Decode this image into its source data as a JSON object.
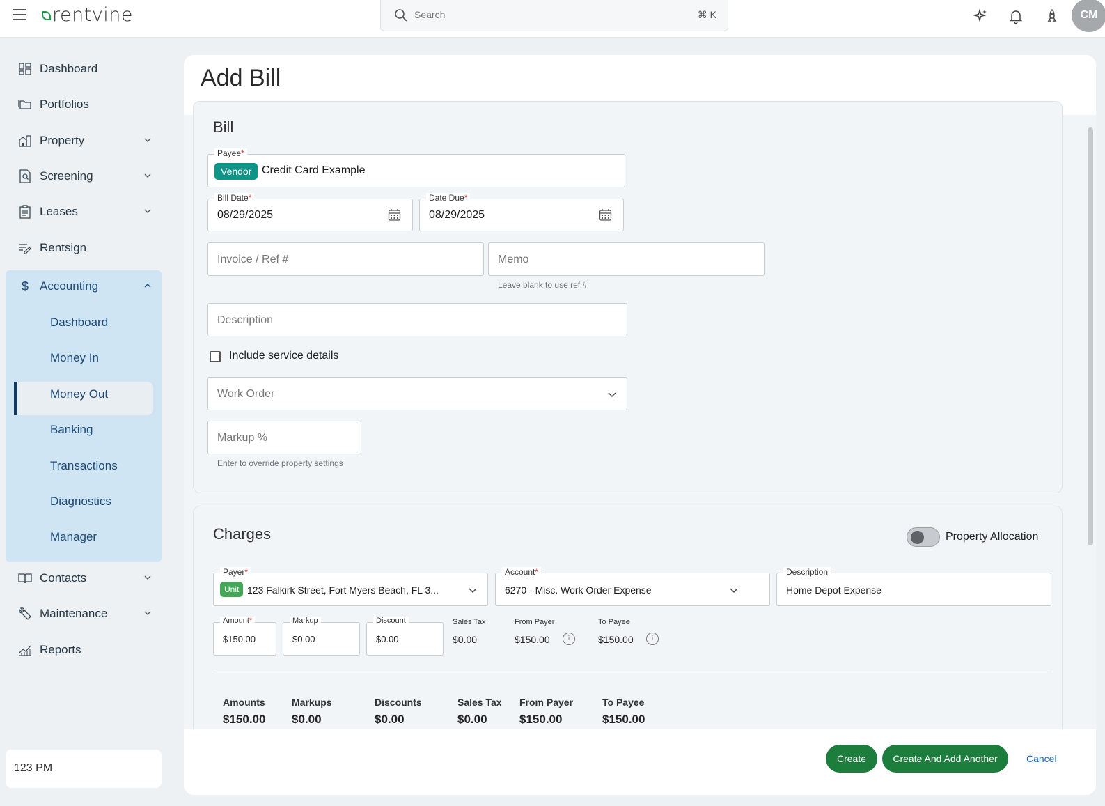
{
  "app": {
    "logo_text": "rentvine"
  },
  "search": {
    "placeholder": "Search",
    "shortcut": "⌘ K"
  },
  "user": {
    "initials": "CM"
  },
  "sidebar": {
    "items": [
      {
        "label": "Dashboard",
        "icon": "grid-icon"
      },
      {
        "label": "Portfolios",
        "icon": "folders-icon"
      },
      {
        "label": "Property",
        "icon": "building-icon"
      },
      {
        "label": "Screening",
        "icon": "document-search-icon"
      },
      {
        "label": "Leases",
        "icon": "clipboard-icon"
      },
      {
        "label": "Rentsign",
        "icon": "signature-icon"
      },
      {
        "label": "Accounting",
        "icon": "dollar-icon"
      },
      {
        "label": "Contacts",
        "icon": "book-icon"
      },
      {
        "label": "Maintenance",
        "icon": "wrench-icon"
      },
      {
        "label": "Reports",
        "icon": "chart-icon"
      }
    ],
    "accounting_sub": [
      "Dashboard",
      "Money In",
      "Money Out",
      "Banking",
      "Transactions",
      "Diagnostics",
      "Manager"
    ],
    "active_sub": "Money Out",
    "footer_time": "123 PM"
  },
  "page": {
    "title": "Add Bill"
  },
  "bill": {
    "section_title": "Bill",
    "payee": {
      "label": "Payee",
      "tag": "Vendor",
      "value": "Credit Card Example"
    },
    "bill_date": {
      "label": "Bill Date",
      "value": "08/29/2025"
    },
    "date_due": {
      "label": "Date Due",
      "value": "08/29/2025"
    },
    "invoice": {
      "placeholder": "Invoice / Ref #"
    },
    "memo": {
      "placeholder": "Memo",
      "helper": "Leave blank to use ref #"
    },
    "description": {
      "placeholder": "Description"
    },
    "service_details": {
      "label": "Include service details",
      "checked": false
    },
    "work_order": {
      "placeholder": "Work Order"
    },
    "markup": {
      "placeholder": "Markup %",
      "helper": "Enter to override property settings"
    }
  },
  "charges": {
    "section_title": "Charges",
    "allocation_label": "Property Allocation",
    "allocation_on": false,
    "payer": {
      "label": "Payer",
      "tag": "Unit",
      "value": "123 Falkirk Street, Fort Myers Beach, FL 3..."
    },
    "account": {
      "label": "Account",
      "value": "6270 - Misc. Work Order Expense"
    },
    "description": {
      "label": "Description",
      "value": "Home Depot Expense"
    },
    "amount": {
      "label": "Amount",
      "value": "$150.00"
    },
    "markup": {
      "label": "Markup",
      "value": "$0.00"
    },
    "discount": {
      "label": "Discount",
      "value": "$0.00"
    },
    "sales_tax": {
      "label": "Sales Tax",
      "value": "$0.00"
    },
    "from_payer": {
      "label": "From Payer",
      "value": "$150.00"
    },
    "to_payee": {
      "label": "To Payee",
      "value": "$150.00"
    },
    "totals": {
      "amounts": {
        "label": "Amounts",
        "value": "$150.00"
      },
      "markups": {
        "label": "Markups",
        "value": "$0.00"
      },
      "discounts": {
        "label": "Discounts",
        "value": "$0.00"
      },
      "sales_tax": {
        "label": "Sales Tax",
        "value": "$0.00"
      },
      "from_payer": {
        "label": "From Payer",
        "value": "$150.00"
      },
      "to_payee": {
        "label": "To Payee",
        "value": "$150.00"
      }
    }
  },
  "actions": {
    "create": "Create",
    "create_another": "Create And Add Another",
    "cancel": "Cancel"
  },
  "colors": {
    "brand_green": "#1d7d3c",
    "vendor_teal": "#0f9488",
    "unit_green": "#46a75a",
    "accounting_panel": "#cfe5f3"
  }
}
